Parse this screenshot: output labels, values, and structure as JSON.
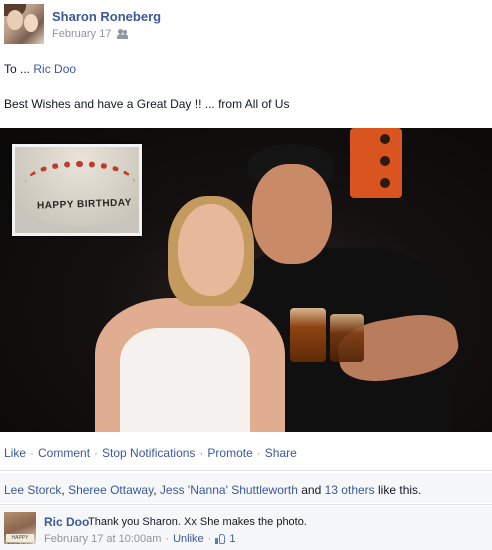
{
  "post": {
    "author": "Sharon Roneberg",
    "date": "February 17",
    "audience_icon": "friends-icon",
    "to_prefix": "To ...",
    "to_name": "Ric Doo",
    "message": "Best Wishes and have a Great Day !! ... from All of Us"
  },
  "photo": {
    "inset_text": "HAPPY BIRTHDAY"
  },
  "actions": {
    "like": "Like",
    "comment": "Comment",
    "stop_notifications": "Stop Notifications",
    "promote": "Promote",
    "share": "Share",
    "separator": "·"
  },
  "likes": {
    "name1": "Lee Storck",
    "name2": "Sheree Ottaway",
    "name3": "Jess 'Nanna' Shuttleworth",
    "and": "and",
    "others": "13 others",
    "suffix": "like this.",
    "comma": ","
  },
  "comment": {
    "author": "Ric Doo",
    "text": "Thank you Sharon. Xx She makes the photo.",
    "date": "February 17 at 10:00am",
    "unlike": "Unlike",
    "like_count": "1",
    "avatar_label": "HAPPY BIRTHDAY"
  },
  "colors": {
    "link": "#3b5998",
    "muted": "#90949c",
    "panel": "#f6f7f8"
  }
}
